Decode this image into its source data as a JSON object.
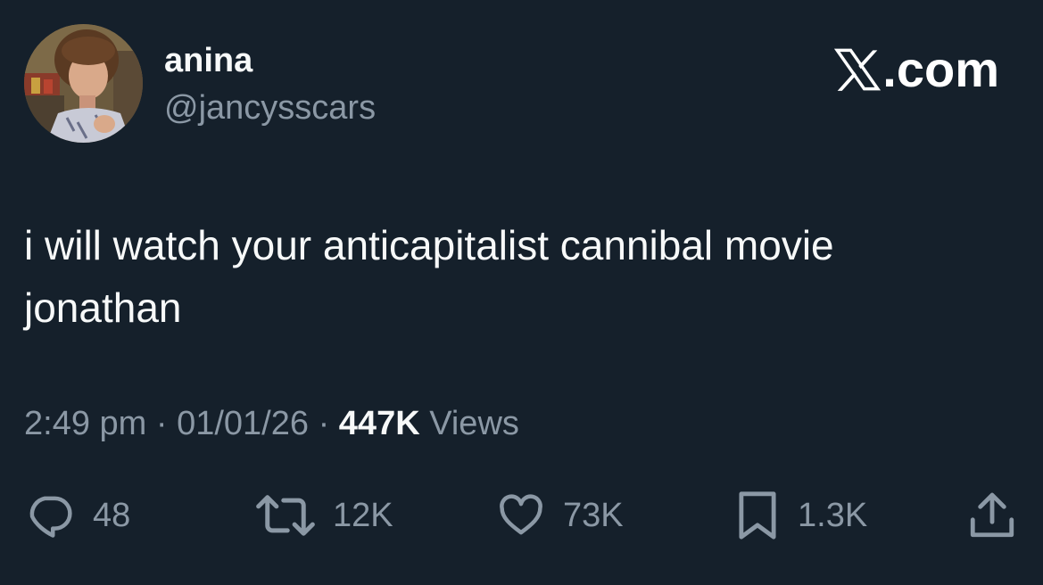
{
  "user": {
    "display_name": "anina",
    "handle": "@jancysscars"
  },
  "brand": {
    "domain_text": ".com",
    "logo_icon": "x-logo-icon"
  },
  "tweet": {
    "lines": [
      "i will watch your anticapitalist cannibal movie",
      "jonathan"
    ],
    "time": "2:49 pm",
    "date": "01/01/26",
    "separator": "·",
    "views_count": "447K",
    "views_label": "Views"
  },
  "actions": {
    "replies": {
      "icon": "reply-icon",
      "count": "48"
    },
    "reposts": {
      "icon": "repost-icon",
      "count": "12K"
    },
    "likes": {
      "icon": "heart-icon",
      "count": "73K"
    },
    "bookmarks": {
      "icon": "bookmark-icon",
      "count": "1.3K"
    },
    "share": {
      "icon": "share-icon"
    }
  },
  "colors": {
    "background": "#15202b",
    "primary_text": "#f7f9f9",
    "secondary_text": "#8b98a5"
  }
}
